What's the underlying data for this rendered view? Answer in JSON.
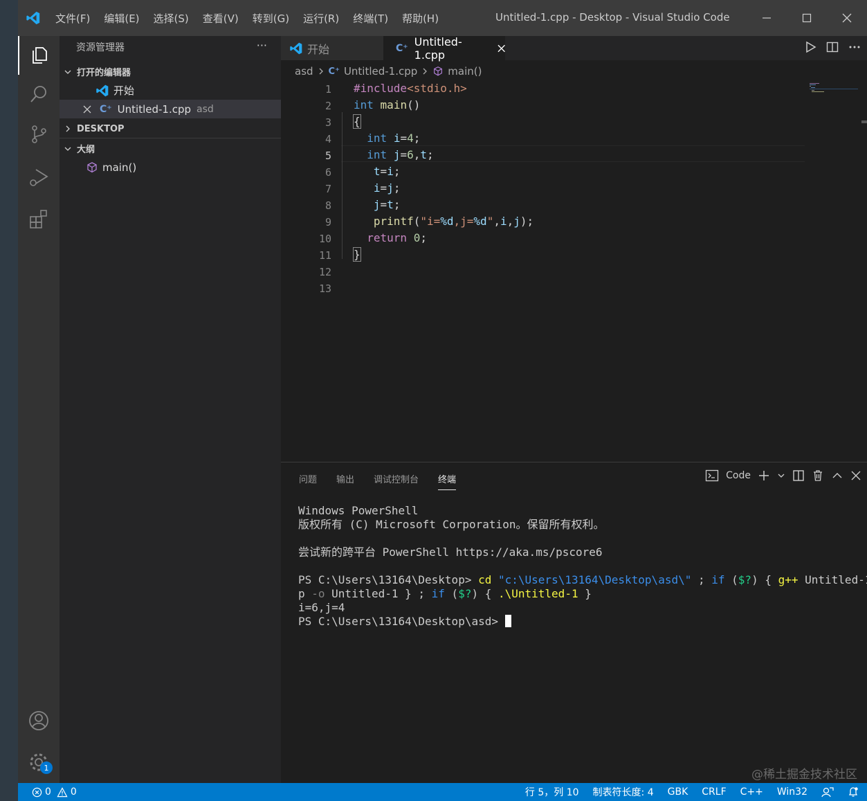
{
  "titlebar": {
    "menu": [
      "文件(F)",
      "编辑(E)",
      "选择(S)",
      "查看(V)",
      "转到(G)",
      "运行(R)",
      "终端(T)",
      "帮助(H)"
    ],
    "title": "Untitled-1.cpp - Desktop - Visual Studio Code"
  },
  "sidebar": {
    "title": "资源管理器",
    "more": "···",
    "open_editors": "打开的编辑器",
    "open_items": [
      {
        "label": "开始",
        "desc": ""
      },
      {
        "label": "Untitled-1.cpp",
        "desc": "asd"
      }
    ],
    "desktop": "DESKTOP",
    "outline": "大纲",
    "outline_items": [
      "main()"
    ]
  },
  "tabs": [
    {
      "label": "开始"
    },
    {
      "label": "Untitled-1.cpp"
    }
  ],
  "breadcrumb": {
    "folder": "asd",
    "file": "Untitled-1.cpp",
    "symbol": "main()"
  },
  "editor": {
    "line_numbers": [
      "1",
      "2",
      "3",
      "4",
      "5",
      "6",
      "7",
      "8",
      "9",
      "10",
      "11",
      "12",
      "13"
    ],
    "current_line": 5
  },
  "panel": {
    "tabs": [
      "问题",
      "输出",
      "调试控制台",
      "终端"
    ],
    "active_tab": "终端",
    "terminal_name": "Code",
    "terminal_lines": [
      "Windows PowerShell",
      "版权所有 (C) Microsoft Corporation。保留所有权利。",
      "",
      "尝试新的跨平台 PowerShell https://aka.ms/pscore6",
      ""
    ],
    "prompt1": "PS C:\\Users\\13164\\Desktop> ",
    "output": "i=6,j=4",
    "prompt2": "PS C:\\Users\\13164\\Desktop\\asd> "
  },
  "status": {
    "errors": "0",
    "warnings": "0",
    "position": "行 5，列 10",
    "tab_size": "制表符长度: 4",
    "encoding": "GBK",
    "eol": "CRLF",
    "language": "C++",
    "platform": "Win32",
    "notifications_badge": "1"
  },
  "watermark": "@稀土掘金技术社区",
  "colors": {
    "accent": "#007acc",
    "keyword": "#569cd6",
    "preprocessor": "#c586c0",
    "string": "#ce9178",
    "function": "#dcdcaa"
  }
}
